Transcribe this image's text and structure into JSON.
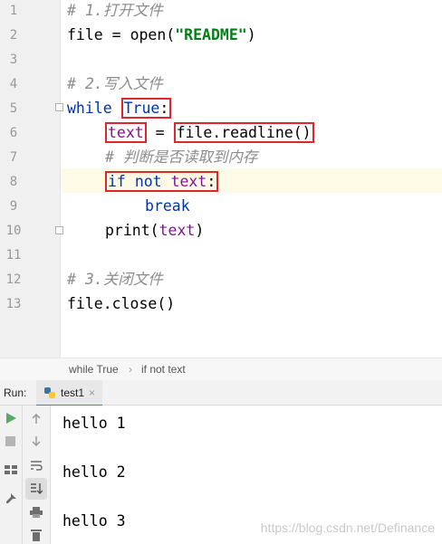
{
  "editor": {
    "line_numbers": [
      "1",
      "2",
      "3",
      "4",
      "5",
      "6",
      "7",
      "8",
      "9",
      "10",
      "11",
      "12",
      "13"
    ],
    "comment1": "# 1.打开文件",
    "l2_var": "file",
    "l2_eq": " = ",
    "l2_func": "open(",
    "l2_str": "\"README\"",
    "l2_end": ")",
    "comment2": "# 2.写入文件",
    "kw_while": "while",
    "kw_true": "True",
    "colon": ":",
    "text_var": "text",
    "eq": " = ",
    "readline_call": "file.readline()",
    "comment_check": "# 判断是否读取到内存",
    "kw_if": "if",
    "kw_not": "not",
    "text_var2": "text",
    "colon2": ":",
    "kw_break": "break",
    "print_func": "print(",
    "print_arg": "text",
    "print_end": ")",
    "comment3": "# 3.关闭文件",
    "close_call": "file.close()"
  },
  "breadcrumb": {
    "item1": "while True",
    "sep": "›",
    "item2": "if not text"
  },
  "run_panel": {
    "label": "Run:",
    "tab_name": "test1",
    "tab_close": "×",
    "output": [
      "hello 1",
      "hello 2",
      "hello 3"
    ]
  },
  "watermark": "https://blog.csdn.net/Definance",
  "colors": {
    "keyword": "#0033b3",
    "string": "#067d17",
    "comment": "#8c8c8c",
    "highlight_box": "#e0262b"
  }
}
